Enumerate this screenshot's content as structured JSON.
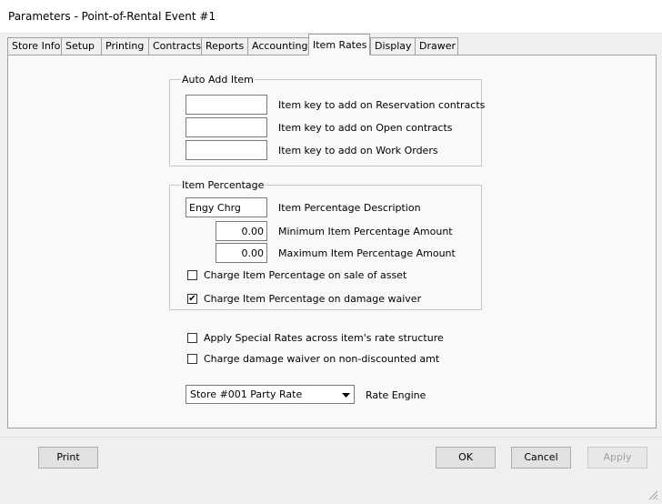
{
  "window": {
    "title": "Parameters - Point-of-Rental Event #1"
  },
  "tabs": [
    {
      "label": "Store Info",
      "active": false
    },
    {
      "label": "Setup",
      "active": false
    },
    {
      "label": "Printing",
      "active": false
    },
    {
      "label": "Contracts",
      "active": false
    },
    {
      "label": "Reports",
      "active": false
    },
    {
      "label": "Accounting",
      "active": false
    },
    {
      "label": "Item Rates",
      "active": true
    },
    {
      "label": "Display",
      "active": false
    },
    {
      "label": "Drawer",
      "active": false
    }
  ],
  "auto_add_item": {
    "legend": "Auto Add Item",
    "fields": [
      {
        "label": "Item key to add on Reservation contracts",
        "value": ""
      },
      {
        "label": "Item key to add on Open contracts",
        "value": ""
      },
      {
        "label": "Item key to add on Work Orders",
        "value": ""
      }
    ]
  },
  "item_percentage": {
    "legend": "Item Percentage",
    "description": {
      "label": "Item Percentage Description",
      "value": "Engy Chrg"
    },
    "minimum": {
      "label": "Minimum Item Percentage Amount",
      "value": "0.00"
    },
    "maximum": {
      "label": "Maximum Item Percentage Amount",
      "value": "0.00"
    },
    "charge_sale_asset": {
      "label": "Charge Item Percentage on sale of asset",
      "checked": false
    },
    "charge_damage_waiver": {
      "label": "Charge Item Percentage on damage waiver",
      "checked": true
    }
  },
  "options": {
    "apply_special_rates": {
      "label": "Apply Special Rates across item's rate structure",
      "checked": false
    },
    "charge_dw_non_discounted": {
      "label": "Charge damage waiver on non-discounted amt",
      "checked": false
    }
  },
  "rate_engine": {
    "label": "Rate Engine",
    "selected": "Store #001 Party Rate"
  },
  "buttons": {
    "print": "Print",
    "ok": "OK",
    "cancel": "Cancel",
    "apply": "Apply"
  },
  "icons": {
    "checkmark": "✔",
    "dropdown": "chevron-down-icon",
    "resize_grip": "resize-grip-icon"
  }
}
